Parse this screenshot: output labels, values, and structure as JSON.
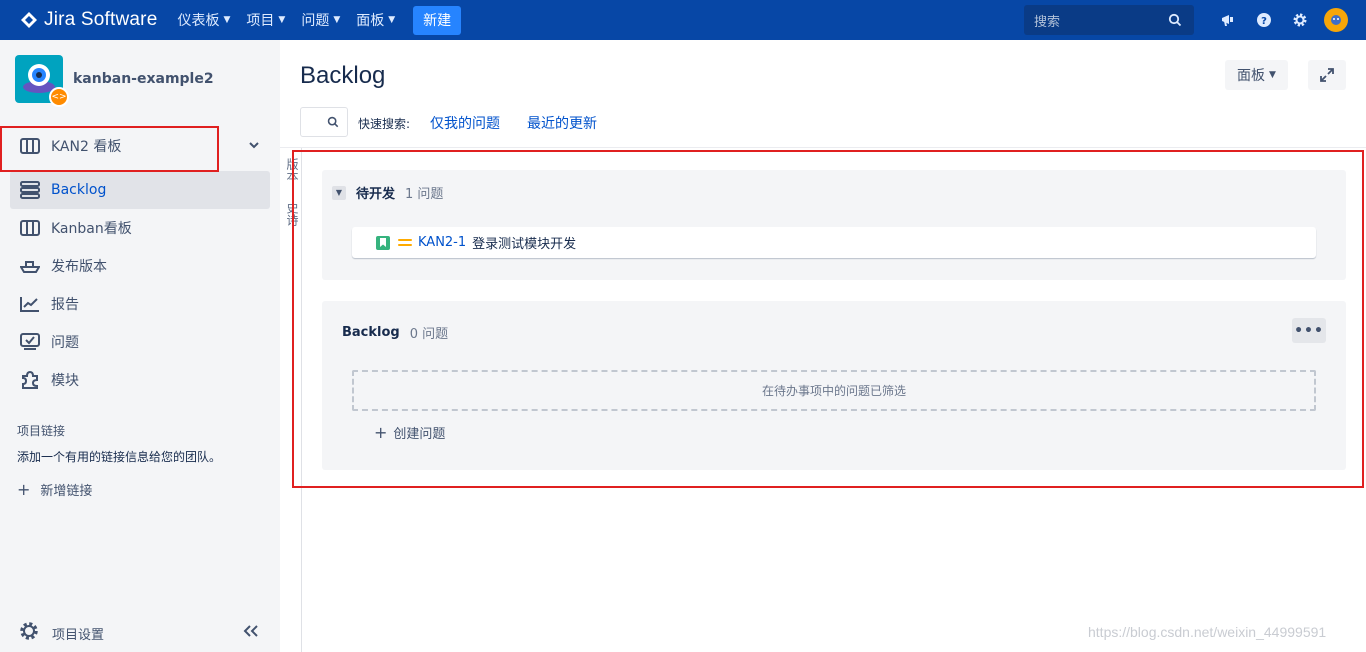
{
  "topnav": {
    "logo": "Jira Software",
    "items": [
      {
        "label": "仪表板"
      },
      {
        "label": "项目"
      },
      {
        "label": "问题"
      },
      {
        "label": "面板"
      }
    ],
    "create_label": "新建",
    "search_placeholder": "搜索"
  },
  "sidebar": {
    "project_name": "kanban-example2",
    "items": [
      {
        "label": "KAN2 看板"
      },
      {
        "label": "Backlog"
      },
      {
        "label": "Kanban看板"
      },
      {
        "label": "发布版本"
      },
      {
        "label": "报告"
      },
      {
        "label": "问题"
      },
      {
        "label": "模块"
      }
    ],
    "links_title": "项目链接",
    "links_desc": "添加一个有用的链接信息给您的团队。",
    "add_link": "新增链接",
    "settings": "项目设置"
  },
  "strip": {
    "text1": "版本",
    "text2": "史诗"
  },
  "main": {
    "title": "Backlog",
    "board_button": "面板",
    "quick_search_label": "快速搜索:",
    "quick_links": [
      "仅我的问题",
      "最近的更新"
    ],
    "sprint": {
      "name": "待开发",
      "count": "1 问题",
      "issues": [
        {
          "key": "KAN2-1",
          "summary": "登录测试模块开发"
        }
      ]
    },
    "backlog": {
      "name": "Backlog",
      "count": "0 问题",
      "empty_text": "在待办事项中的问题已筛选",
      "create_label": "创建问题"
    }
  },
  "watermark": "https://blog.csdn.net/weixin_44999591",
  "colors": {
    "nav": "#0747a6",
    "accent": "#0052cc",
    "highlight": "#e02020"
  }
}
